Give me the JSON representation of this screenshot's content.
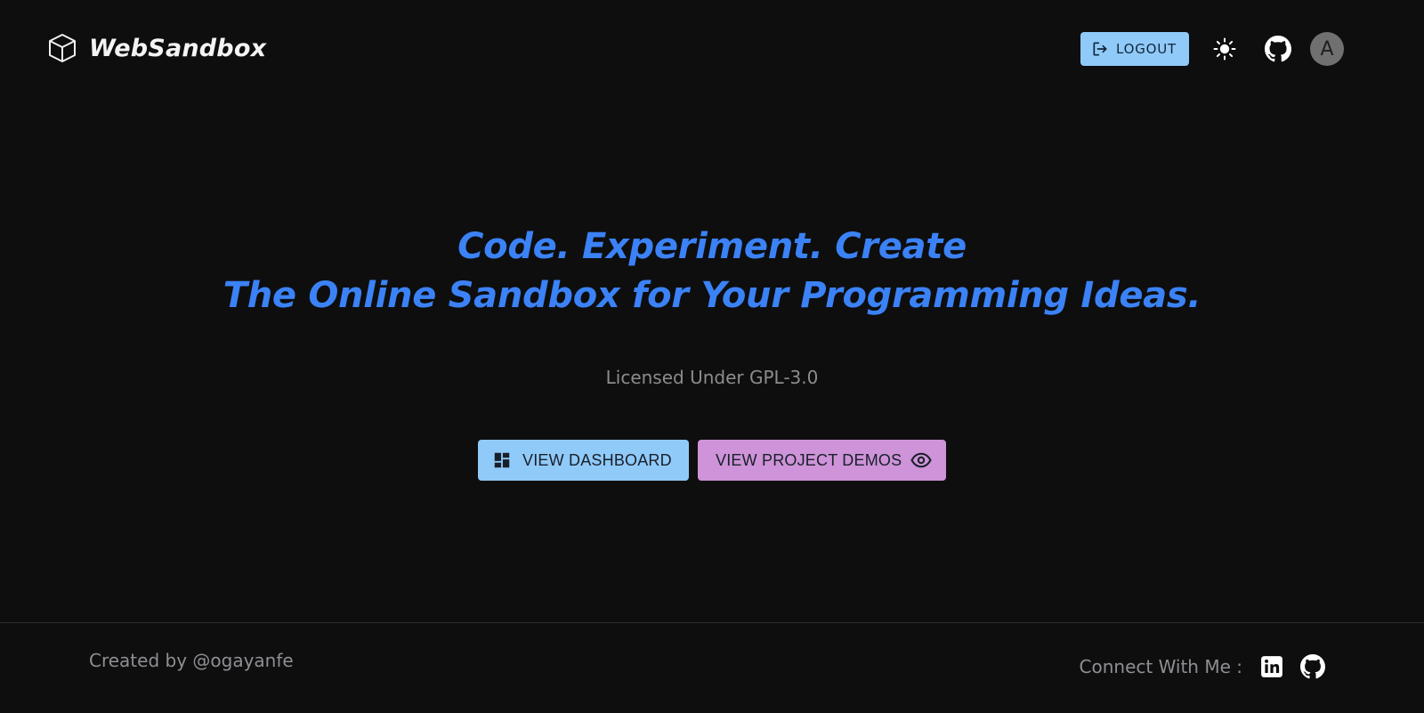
{
  "header": {
    "brand_name": "WebSandbox",
    "logout_label": "LOGOUT",
    "avatar_initial": "A"
  },
  "hero": {
    "title_line1": "Code. Experiment. Create",
    "title_line2": "The Online Sandbox for Your Programming Ideas.",
    "license": "Licensed Under GPL-3.0",
    "dashboard_button": "VIEW DASHBOARD",
    "demos_button": "VIEW PROJECT DEMOS"
  },
  "footer": {
    "credit": "Created by @ogayanfe",
    "connect_label": "Connect With Me :"
  },
  "icons": {
    "brand": "cube-icon",
    "logout": "logout-icon",
    "theme": "sun-icon",
    "github": "github-icon",
    "dashboard": "dashboard-icon",
    "demos": "eye-icon",
    "linkedin": "linkedin-icon"
  },
  "colors": {
    "background": "#0e0e0f",
    "primary": "#90caf9",
    "secondary": "#ce93d8",
    "hero_text": "#3b82f6",
    "muted_text": "#8c8c8f"
  }
}
